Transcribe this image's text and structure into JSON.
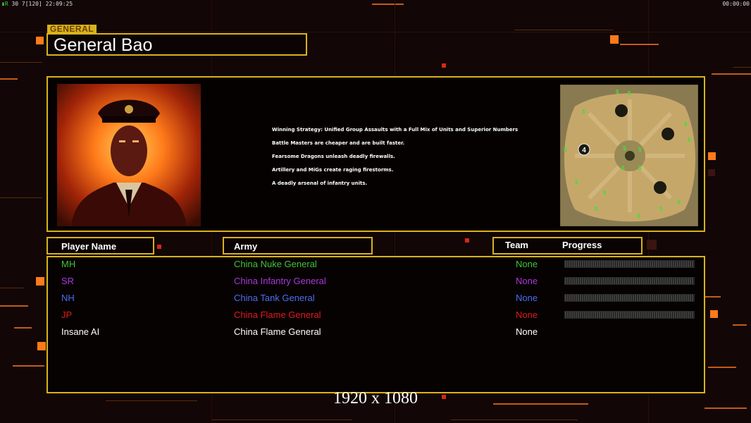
{
  "hud": {
    "status_left": "30 7[120] 22:09:25",
    "status_right": "00:00:00"
  },
  "general": {
    "tag": "GENERAL",
    "name": "General Bao"
  },
  "strategy": [
    "Winning Strategy: Unified Group Assaults with a Full Mix of Units and Superior Numbers",
    "Battle Masters are cheaper and are built faster.",
    "Fearsome Dragons unleash deadly firewalls.",
    "Artillery and MiGs create raging firestorms.",
    "A deadly arsenal of infantry units."
  ],
  "minimap": {
    "start_position_label": "4"
  },
  "headers": {
    "player_name": "Player Name",
    "army": "Army",
    "team": "Team",
    "progress": "Progress"
  },
  "players": [
    {
      "name": "MH",
      "army": "China Nuke General",
      "team": "None",
      "color": "#3fc43a",
      "has_progress": true
    },
    {
      "name": "SR",
      "army": "China Infantry General",
      "team": "None",
      "color": "#a63ad9",
      "has_progress": true
    },
    {
      "name": "NH",
      "army": "China Tank General",
      "team": "None",
      "color": "#4a6ef0",
      "has_progress": true
    },
    {
      "name": "JP",
      "army": "China Flame General",
      "team": "None",
      "color": "#e01a1a",
      "has_progress": true
    },
    {
      "name": "Insane AI",
      "army": "China Flame General",
      "team": "None",
      "color": "#ffffff",
      "has_progress": false
    }
  ],
  "resolution_label": "1920 x 1080",
  "colors": {
    "accent_gold": "#d9b21a",
    "highlight_orange": "#ff7a1a",
    "background": "#120606"
  }
}
